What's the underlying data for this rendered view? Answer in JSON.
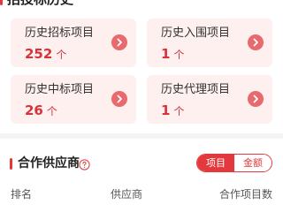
{
  "history": {
    "title": "招投标历史",
    "cards": [
      {
        "label": "历史招标项目",
        "value": "252",
        "unit": "个"
      },
      {
        "label": "历史入围项目",
        "value": "1",
        "unit": "个"
      },
      {
        "label": "历史中标项目",
        "value": "26",
        "unit": "个"
      },
      {
        "label": "历史代理项目",
        "value": "1",
        "unit": "个"
      }
    ],
    "arrow_icon": "chevron-right-icon"
  },
  "partners": {
    "title": "合作供应商",
    "help_icon": "question-circle-icon",
    "toggle": {
      "options": [
        "项目",
        "金额"
      ],
      "selected": "项目"
    },
    "columns": [
      "排名",
      "供应商",
      "合作项目数"
    ]
  },
  "colors": {
    "accent": "#e4393c",
    "value_red": "#d8323a",
    "card_bg": "#fdf0ef",
    "arrow_bg": "#e86a6d",
    "divider": "#f4f4f4"
  }
}
